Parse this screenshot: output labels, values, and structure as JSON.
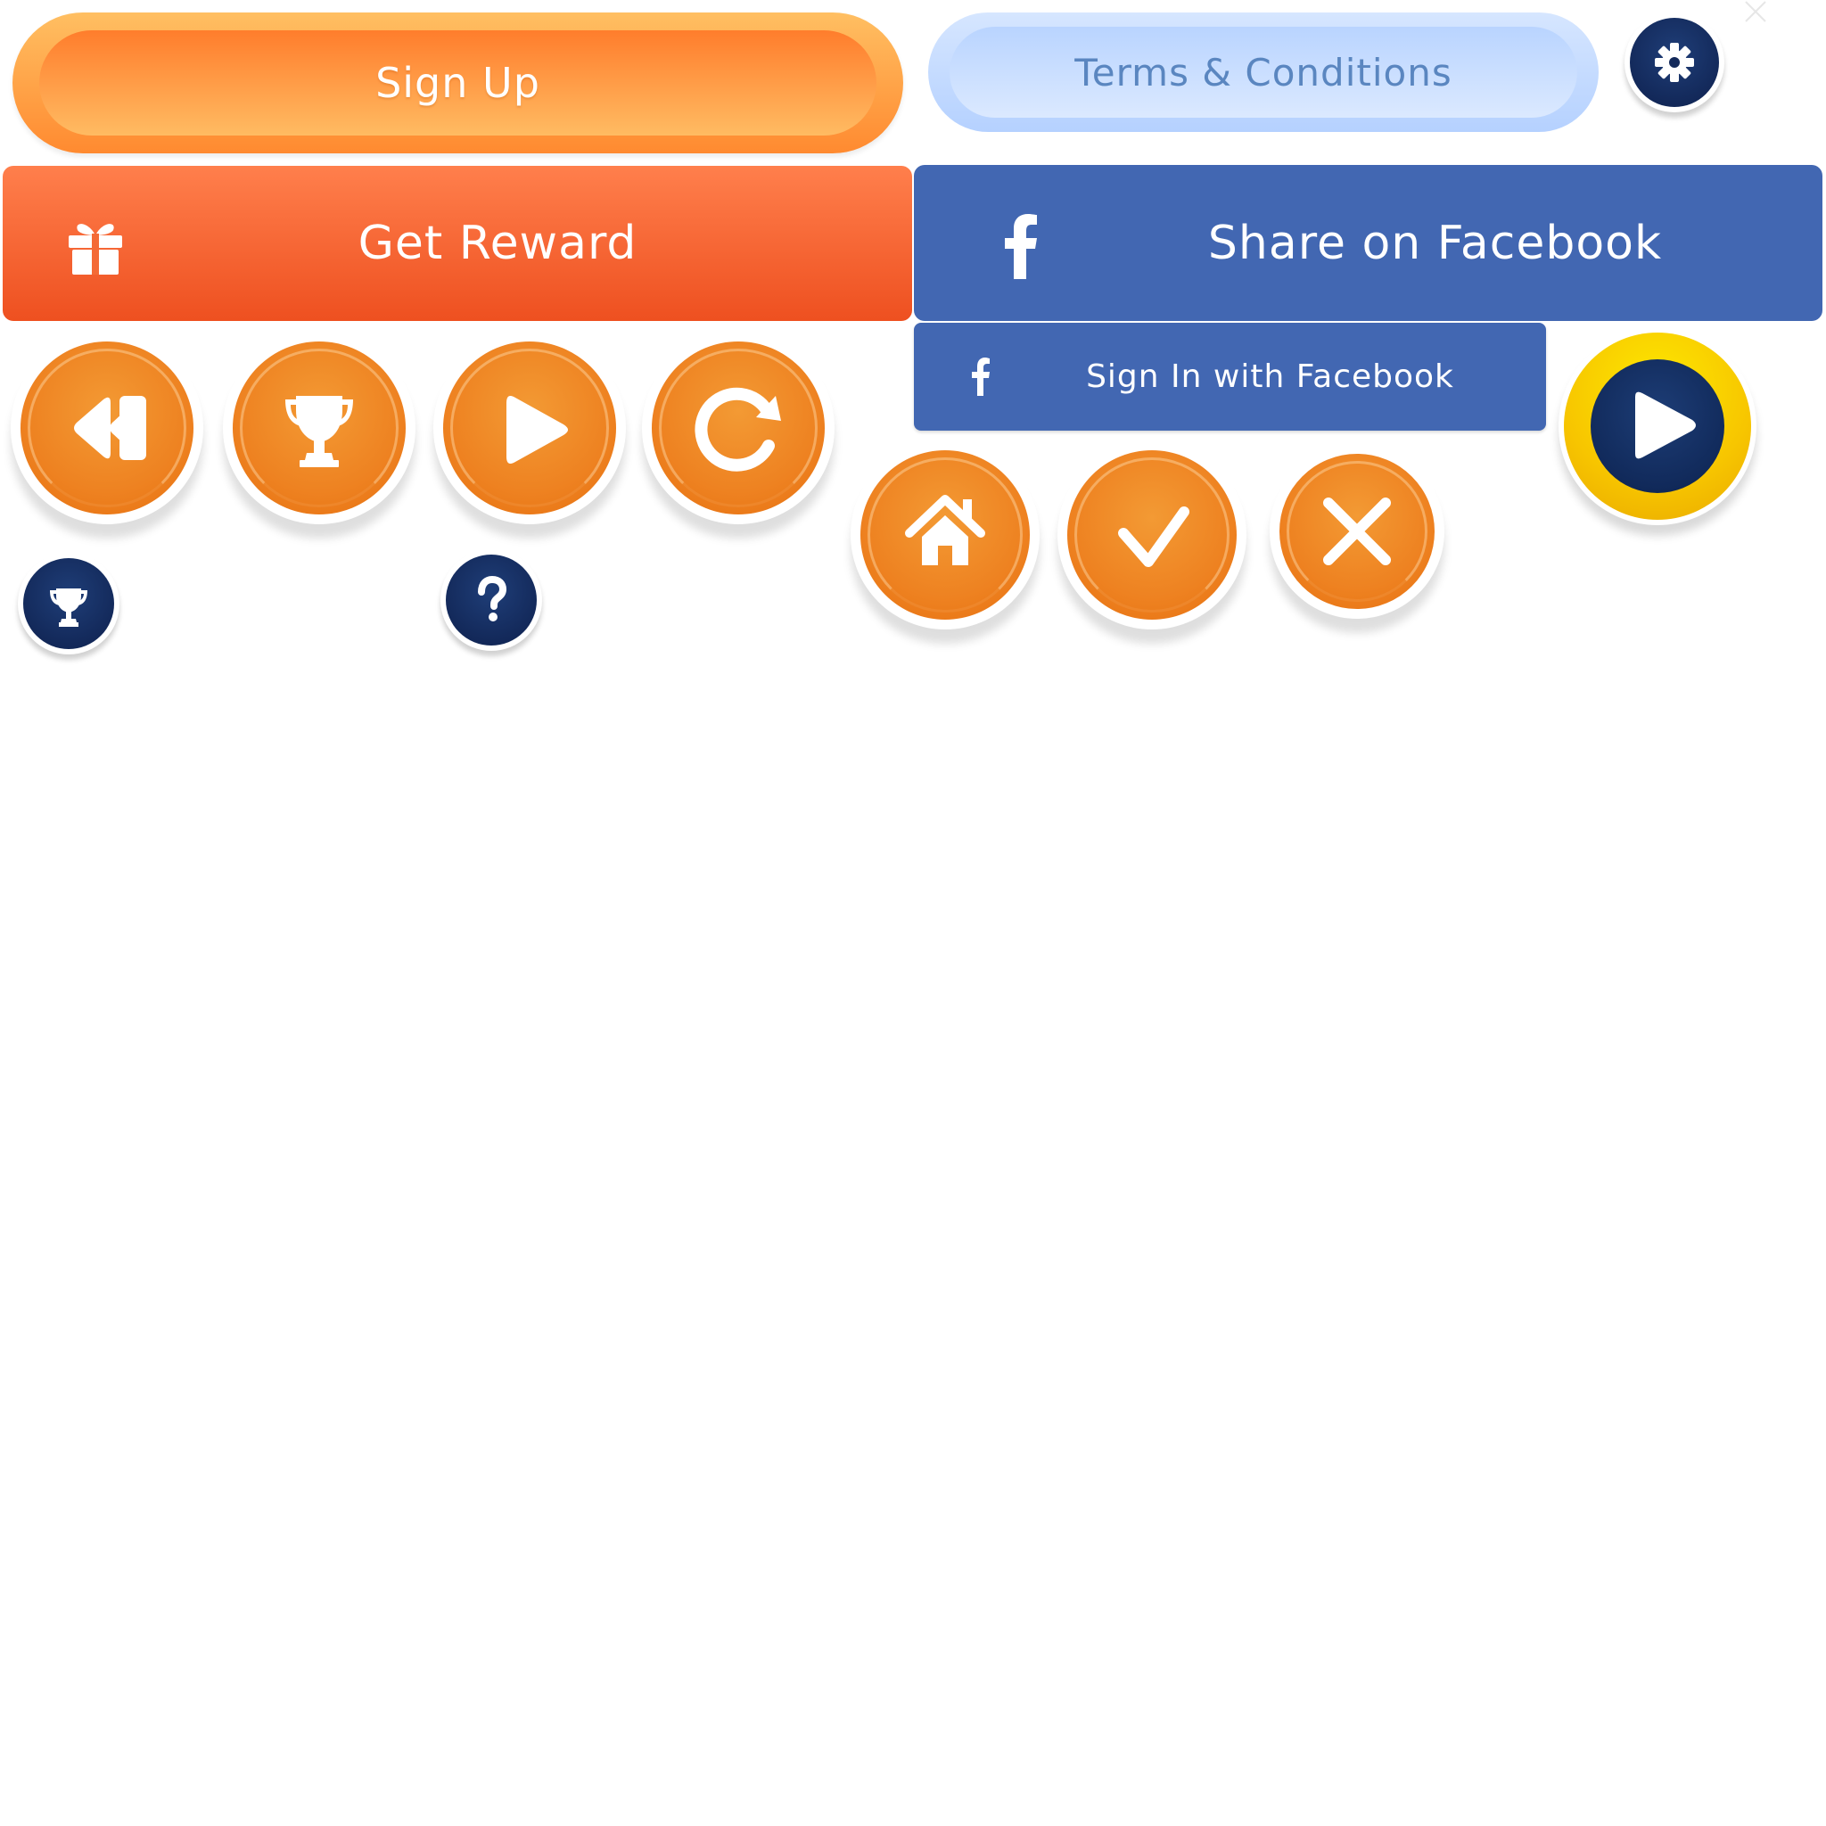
{
  "buttons": {
    "sign_up": "Sign Up",
    "terms": "Terms & Conditions",
    "get_reward": "Get Reward",
    "share_facebook": "Share on Facebook",
    "sign_in_facebook": "Sign In with Facebook"
  },
  "icons": {
    "settings": "gear-icon",
    "gift": "gift-icon",
    "facebook": "facebook-icon",
    "rewind": "rewind-icon",
    "trophy": "trophy-icon",
    "play": "play-icon",
    "replay": "replay-icon",
    "home": "home-icon",
    "check": "check-icon",
    "close": "close-icon",
    "help": "question-icon"
  },
  "colors": {
    "orange_accent": "#ee8221",
    "reward_orange": "#ee5020",
    "facebook_blue": "#4267b2",
    "navy": "#13295a",
    "gold": "#f7c500",
    "terms_blue": "#5a86c0"
  }
}
